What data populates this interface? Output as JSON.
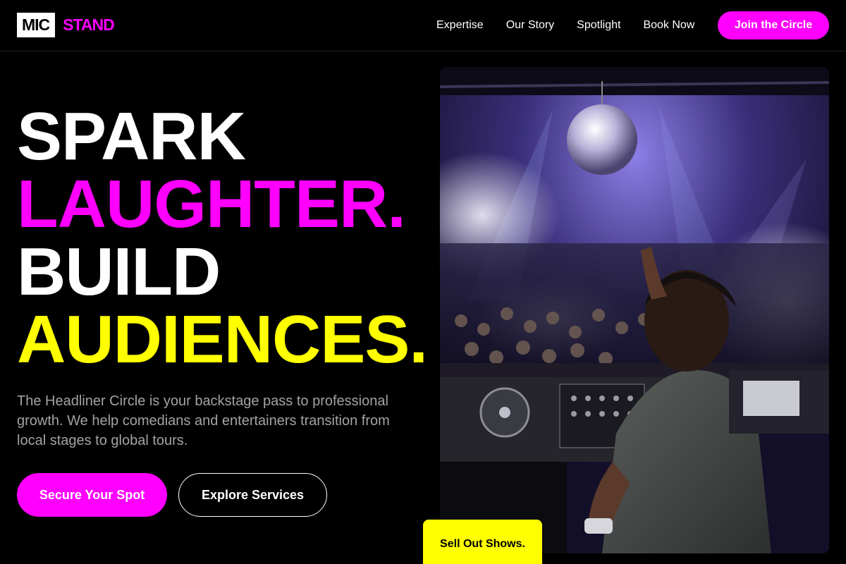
{
  "brand": {
    "logo_box": "MIC",
    "logo_word": "STAND",
    "accent_magenta": "#ff00ff",
    "accent_yellow": "#ffff00"
  },
  "nav": {
    "items": [
      {
        "label": "Expertise"
      },
      {
        "label": "Our Story"
      },
      {
        "label": "Spotlight"
      },
      {
        "label": "Book Now"
      }
    ],
    "cta_label": "Join the Circle"
  },
  "hero": {
    "headline": [
      "SPARK",
      "LAUGHTER.",
      "BUILD",
      "AUDIENCES."
    ],
    "lead": "The Headliner Circle is your backstage pass to professional growth. We help comedians and entertainers transition from local stages to global tours.",
    "primary_button": "Secure Your Spot",
    "secondary_button": "Explore Services",
    "image_subject": "dj-performing-at-club-photo",
    "badge": "Sell Out Shows."
  }
}
